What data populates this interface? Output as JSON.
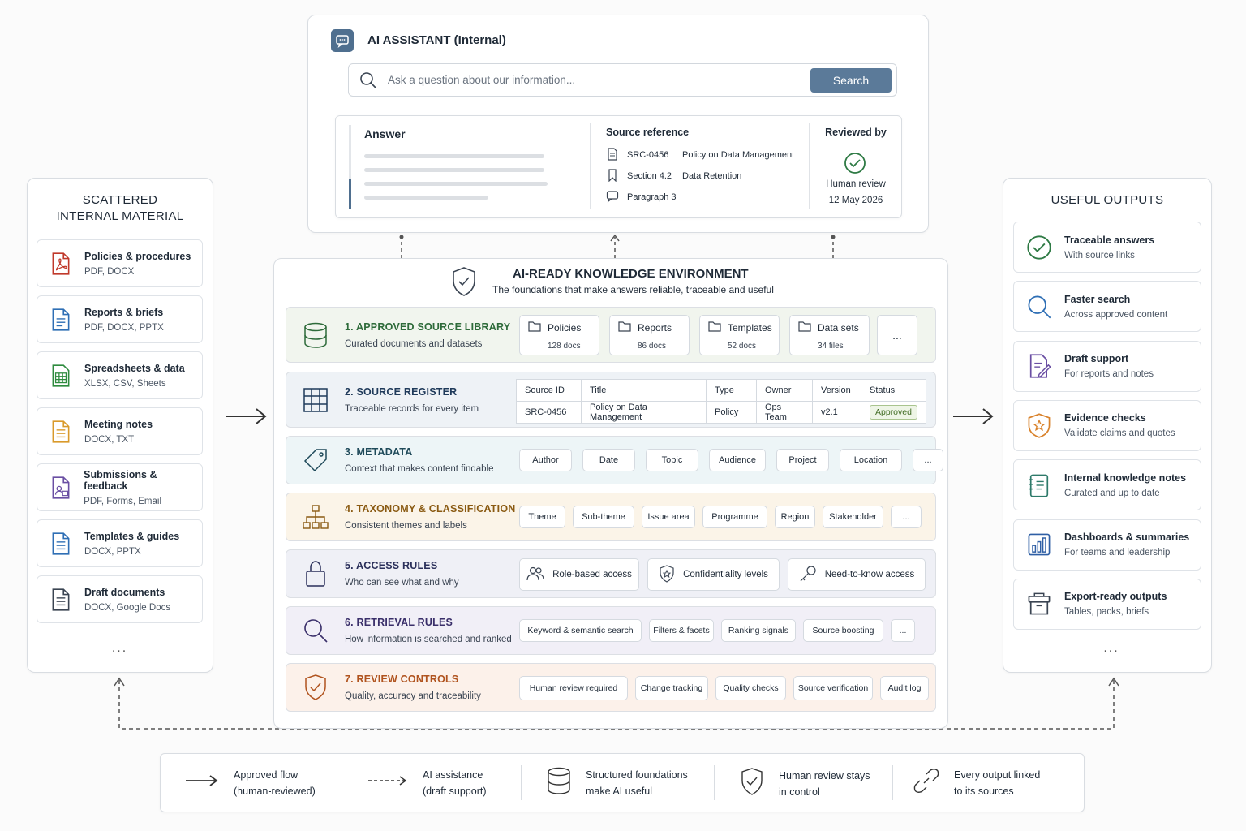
{
  "left_panel": {
    "title_line1": "SCATTERED",
    "title_line2": "INTERNAL MATERIAL",
    "items": [
      {
        "label": "Policies & procedures",
        "formats": "PDF, DOCX",
        "icon": "pdf-icon",
        "color": "#c0392b"
      },
      {
        "label": "Reports & briefs",
        "formats": "PDF, DOCX, PPTX",
        "icon": "document-icon",
        "color": "#2f6fb5"
      },
      {
        "label": "Spreadsheets & data",
        "formats": "XLSX, CSV, Sheets",
        "icon": "spreadsheet-icon",
        "color": "#2e8b3e"
      },
      {
        "label": "Meeting notes",
        "formats": "DOCX, TXT",
        "icon": "notes-icon",
        "color": "#d99a2b"
      },
      {
        "label": "Submissions & feedback",
        "formats": "PDF, Forms, Email",
        "icon": "submission-icon",
        "color": "#6a4fa3"
      },
      {
        "label": "Templates & guides",
        "formats": "DOCX, PPTX",
        "icon": "template-icon",
        "color": "#2f6fb5"
      },
      {
        "label": "Draft documents",
        "formats": "DOCX, Google Docs",
        "icon": "draft-icon",
        "color": "#3a4452"
      }
    ],
    "more": "..."
  },
  "assistant": {
    "title": "AI ASSISTANT (Internal)",
    "search_placeholder": "Ask a question about our information...",
    "search_button": "Search",
    "answer_label": "Answer",
    "source_label": "Source reference",
    "sources": [
      {
        "code": "SRC-0456",
        "text": "Policy on Data Management",
        "icon": "document-icon"
      },
      {
        "code": "Section 4.2",
        "text": "Data Retention",
        "icon": "bookmark-icon"
      },
      {
        "code": "Paragraph 3",
        "text": "",
        "icon": "comment-icon"
      }
    ],
    "reviewed_label": "Reviewed by",
    "reviewer": "Human review",
    "review_date": "12 May 2026"
  },
  "environment": {
    "title": "AI-READY KNOWLEDGE ENVIRONMENT",
    "subtitle": "The foundations that make answers reliable, traceable and useful",
    "library": {
      "title": "1. APPROVED SOURCE LIBRARY",
      "subtitle": "Curated documents and datasets",
      "color": "#2e6b3a",
      "items": [
        {
          "label": "Policies",
          "count": "128 docs"
        },
        {
          "label": "Reports",
          "count": "86 docs"
        },
        {
          "label": "Templates",
          "count": "52 docs"
        },
        {
          "label": "Data sets",
          "count": "34 files"
        }
      ],
      "more": "..."
    },
    "register": {
      "title": "2. SOURCE REGISTER",
      "subtitle": "Traceable records for every item",
      "color": "#1f3a5a",
      "headers": [
        "Source ID",
        "Title",
        "Type",
        "Owner",
        "Version",
        "Status"
      ],
      "row": [
        "SRC-0456",
        "Policy on Data Management",
        "Policy",
        "Ops Team",
        "v2.1",
        "Approved"
      ]
    },
    "metadata": {
      "title": "3. METADATA",
      "subtitle": "Context that makes content findable",
      "color": "#1f4a5a",
      "chips": [
        "Author",
        "Date",
        "Topic",
        "Audience",
        "Project",
        "Location",
        "..."
      ]
    },
    "taxonomy": {
      "title": "4. TAXONOMY & CLASSIFICATION",
      "subtitle": "Consistent themes and labels",
      "color": "#8a5a12",
      "chips": [
        "Theme",
        "Sub-theme",
        "Issue area",
        "Programme",
        "Region",
        "Stakeholder",
        "..."
      ]
    },
    "access": {
      "title": "5. ACCESS RULES",
      "subtitle": "Who can see what and why",
      "color": "#2a2f5a",
      "chips": [
        "Role-based access",
        "Confidentiality levels",
        "Need-to-know access"
      ]
    },
    "retrieval": {
      "title": "6. RETRIEVAL RULES",
      "subtitle": "How information is searched and ranked",
      "color": "#3a2f6a",
      "chips": [
        "Keyword & semantic search",
        "Filters & facets",
        "Ranking signals",
        "Source boosting",
        "..."
      ]
    },
    "review": {
      "title": "7. REVIEW CONTROLS",
      "subtitle": "Quality, accuracy and traceability",
      "color": "#b0531e",
      "chips": [
        "Human review required",
        "Change tracking",
        "Quality checks",
        "Source verification",
        "Audit log"
      ]
    }
  },
  "right_panel": {
    "title": "USEFUL OUTPUTS",
    "items": [
      {
        "label": "Traceable answers",
        "desc": "With source links",
        "icon": "check-circle-icon",
        "color": "#2e7a44"
      },
      {
        "label": "Faster search",
        "desc": "Across approved content",
        "icon": "search-icon",
        "color": "#2f6fb5"
      },
      {
        "label": "Draft support",
        "desc": "For reports and notes",
        "icon": "edit-document-icon",
        "color": "#6a4fa3"
      },
      {
        "label": "Evidence checks",
        "desc": "Validate claims and quotes",
        "icon": "shield-star-icon",
        "color": "#d9822b"
      },
      {
        "label": "Internal knowledge notes",
        "desc": "Curated and up to date",
        "icon": "notebook-icon",
        "color": "#2e7a6a"
      },
      {
        "label": "Dashboards & summaries",
        "desc": "For teams and leadership",
        "icon": "bar-chart-icon",
        "color": "#2f5fa5"
      },
      {
        "label": "Export-ready outputs",
        "desc": "Tables, packs, briefs",
        "icon": "archive-box-icon",
        "color": "#3a4452"
      }
    ],
    "more": "..."
  },
  "legend": [
    {
      "line1": "Approved flow",
      "line2": "(human-reviewed)",
      "icon": "solid-arrow-icon"
    },
    {
      "line1": "AI assistance",
      "line2": "(draft support)",
      "icon": "dashed-arrow-icon"
    },
    {
      "line1": "Structured foundations",
      "line2": "make AI useful",
      "icon": "database-icon"
    },
    {
      "line1": "Human review stays",
      "line2": "in control",
      "icon": "shield-check-icon"
    },
    {
      "line1": "Every output linked",
      "line2": "to its sources",
      "icon": "link-icon"
    }
  ]
}
